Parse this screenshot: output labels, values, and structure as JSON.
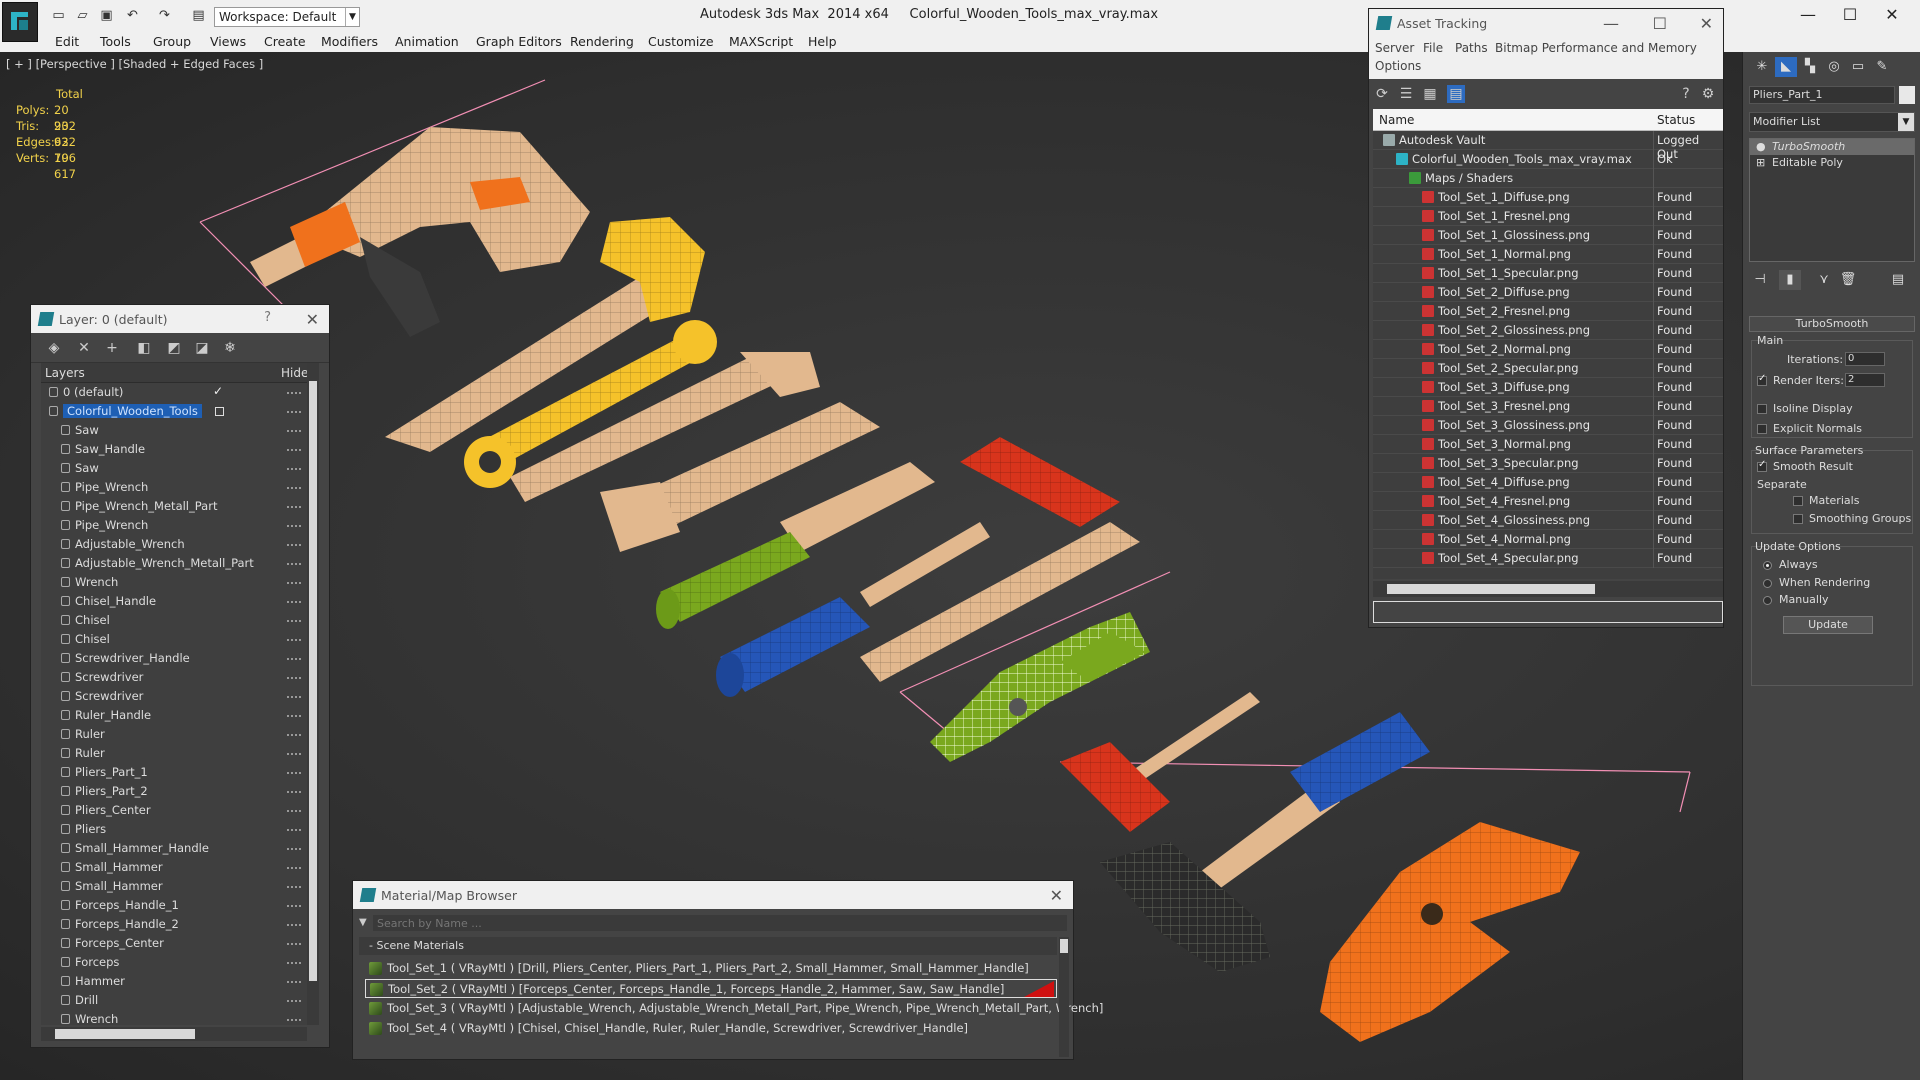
{
  "app": {
    "title": "Autodesk 3ds Max  2014 x64     Colorful_Wooden_Tools_max_vray.max",
    "workspace": "Workspace: Default",
    "window_controls": {
      "minimize": "—",
      "maximize": "☐",
      "close": "✕"
    }
  },
  "menu": [
    "Edit",
    "Tools",
    "Group",
    "Views",
    "Create",
    "Modifiers",
    "Animation",
    "Graph Editors",
    "Rendering",
    "Customize",
    "MAXScript",
    "Help"
  ],
  "viewport": {
    "label": "[ + ] [Perspective ] [Shaded + Edged Faces ]",
    "stats": {
      "header": "Total",
      "rows": [
        {
          "label": "Polys:",
          "value": "20 932"
        },
        {
          "label": "Tris:",
          "value": "20 932"
        },
        {
          "label": "Edges:",
          "value": "62 796"
        },
        {
          "label": "Verts:",
          "value": "10 617"
        }
      ]
    }
  },
  "layer_panel": {
    "title": "Layer: 0 (default)",
    "help": "?",
    "col_layers": "Layers",
    "col_hide": "Hide",
    "layers": [
      {
        "name": "0 (default)",
        "level": 1,
        "type": "layer",
        "checked": true
      },
      {
        "name": "Colorful_Wooden_Tools",
        "level": 1,
        "type": "layer",
        "selected": true
      },
      {
        "name": "Saw",
        "level": 2
      },
      {
        "name": "Saw_Handle",
        "level": 2
      },
      {
        "name": "Saw",
        "level": 2
      },
      {
        "name": "Pipe_Wrench",
        "level": 2
      },
      {
        "name": "Pipe_Wrench_Metall_Part",
        "level": 2
      },
      {
        "name": "Pipe_Wrench",
        "level": 2
      },
      {
        "name": "Adjustable_Wrench",
        "level": 2
      },
      {
        "name": "Adjustable_Wrench_Metall_Part",
        "level": 2
      },
      {
        "name": "Wrench",
        "level": 2
      },
      {
        "name": "Chisel_Handle",
        "level": 2
      },
      {
        "name": "Chisel",
        "level": 2
      },
      {
        "name": "Chisel",
        "level": 2
      },
      {
        "name": "Screwdriver_Handle",
        "level": 2
      },
      {
        "name": "Screwdriver",
        "level": 2
      },
      {
        "name": "Screwdriver",
        "level": 2
      },
      {
        "name": "Ruler_Handle",
        "level": 2
      },
      {
        "name": "Ruler",
        "level": 2
      },
      {
        "name": "Ruler",
        "level": 2
      },
      {
        "name": "Pliers_Part_1",
        "level": 2
      },
      {
        "name": "Pliers_Part_2",
        "level": 2
      },
      {
        "name": "Pliers_Center",
        "level": 2
      },
      {
        "name": "Pliers",
        "level": 2
      },
      {
        "name": "Small_Hammer_Handle",
        "level": 2
      },
      {
        "name": "Small_Hammer",
        "level": 2
      },
      {
        "name": "Small_Hammer",
        "level": 2
      },
      {
        "name": "Forceps_Handle_1",
        "level": 2
      },
      {
        "name": "Forceps_Handle_2",
        "level": 2
      },
      {
        "name": "Forceps_Center",
        "level": 2
      },
      {
        "name": "Forceps",
        "level": 2
      },
      {
        "name": "Hammer",
        "level": 2
      },
      {
        "name": "Drill",
        "level": 2
      },
      {
        "name": "Wrench",
        "level": 2
      }
    ]
  },
  "asset_panel": {
    "title": "Asset Tracking",
    "menu": [
      "Server",
      "File",
      "Paths",
      "Bitmap Performance and Memory",
      "Options"
    ],
    "col_name": "Name",
    "col_status": "Status",
    "rows": [
      {
        "name": "Autodesk Vault",
        "status": "Logged Out",
        "indent": 1,
        "icon": "vault"
      },
      {
        "name": "Colorful_Wooden_Tools_max_vray.max",
        "status": "Ok",
        "indent": 2,
        "icon": "max"
      },
      {
        "name": "Maps / Shaders",
        "status": "",
        "indent": 3,
        "icon": "maps"
      },
      {
        "name": "Tool_Set_1_Diffuse.png",
        "status": "Found",
        "indent": 4,
        "icon": "png"
      },
      {
        "name": "Tool_Set_1_Fresnel.png",
        "status": "Found",
        "indent": 4,
        "icon": "png"
      },
      {
        "name": "Tool_Set_1_Glossiness.png",
        "status": "Found",
        "indent": 4,
        "icon": "png"
      },
      {
        "name": "Tool_Set_1_Normal.png",
        "status": "Found",
        "indent": 4,
        "icon": "png"
      },
      {
        "name": "Tool_Set_1_Specular.png",
        "status": "Found",
        "indent": 4,
        "icon": "png"
      },
      {
        "name": "Tool_Set_2_Diffuse.png",
        "status": "Found",
        "indent": 4,
        "icon": "png"
      },
      {
        "name": "Tool_Set_2_Fresnel.png",
        "status": "Found",
        "indent": 4,
        "icon": "png"
      },
      {
        "name": "Tool_Set_2_Glossiness.png",
        "status": "Found",
        "indent": 4,
        "icon": "png"
      },
      {
        "name": "Tool_Set_2_Normal.png",
        "status": "Found",
        "indent": 4,
        "icon": "png"
      },
      {
        "name": "Tool_Set_2_Specular.png",
        "status": "Found",
        "indent": 4,
        "icon": "png"
      },
      {
        "name": "Tool_Set_3_Diffuse.png",
        "status": "Found",
        "indent": 4,
        "icon": "png"
      },
      {
        "name": "Tool_Set_3_Fresnel.png",
        "status": "Found",
        "indent": 4,
        "icon": "png"
      },
      {
        "name": "Tool_Set_3_Glossiness.png",
        "status": "Found",
        "indent": 4,
        "icon": "png"
      },
      {
        "name": "Tool_Set_3_Normal.png",
        "status": "Found",
        "indent": 4,
        "icon": "png"
      },
      {
        "name": "Tool_Set_3_Specular.png",
        "status": "Found",
        "indent": 4,
        "icon": "png"
      },
      {
        "name": "Tool_Set_4_Diffuse.png",
        "status": "Found",
        "indent": 4,
        "icon": "png"
      },
      {
        "name": "Tool_Set_4_Fresnel.png",
        "status": "Found",
        "indent": 4,
        "icon": "png"
      },
      {
        "name": "Tool_Set_4_Glossiness.png",
        "status": "Found",
        "indent": 4,
        "icon": "png"
      },
      {
        "name": "Tool_Set_4_Normal.png",
        "status": "Found",
        "indent": 4,
        "icon": "png"
      },
      {
        "name": "Tool_Set_4_Specular.png",
        "status": "Found",
        "indent": 4,
        "icon": "png"
      }
    ]
  },
  "command_panel": {
    "object_name": "Pliers_Part_1",
    "modifier_list": "Modifier List",
    "stack": [
      {
        "name": "TurboSmooth",
        "active": true
      },
      {
        "name": "Editable Poly",
        "active": false
      }
    ],
    "rollout_title": "TurboSmooth",
    "main_label": "Main",
    "iterations_label": "Iterations:",
    "iterations_value": "0",
    "render_iters_label": "Render Iters:",
    "render_iters_value": "2",
    "isoline_label": "Isoline Display",
    "explicit_normals_label": "Explicit Normals",
    "surface_params_label": "Surface Parameters",
    "smooth_result_label": "Smooth Result",
    "separate_label": "Separate",
    "materials_label": "Materials",
    "smoothing_groups_label": "Smoothing Groups",
    "update_options_label": "Update Options",
    "always_label": "Always",
    "when_rendering_label": "When Rendering",
    "manually_label": "Manually",
    "update_button": "Update"
  },
  "material_browser": {
    "title": "Material/Map Browser",
    "search_placeholder": "Search by Name ...",
    "group_title": "Scene Materials",
    "materials": [
      "Tool_Set_1  ( VRayMtl )  [Drill, Pliers_Center, Pliers_Part_1, Pliers_Part_2, Small_Hammer, Small_Hammer_Handle]",
      "Tool_Set_2  ( VRayMtl )  [Forceps_Center, Forceps_Handle_1, Forceps_Handle_2, Hammer, Saw, Saw_Handle]",
      "Tool_Set_3  ( VRayMtl )  [Adjustable_Wrench, Adjustable_Wrench_Metall_Part, Pipe_Wrench, Pipe_Wrench_Metall_Part, Wrench]",
      "Tool_Set_4  ( VRayMtl )  [Chisel, Chisel_Handle, Ruler, Ruler_Handle, Screwdriver, Screwdriver_Handle]"
    ]
  },
  "colors": {
    "wood": "#e2b88e",
    "orange": "#f0711c",
    "yellow": "#f5c22a",
    "green": "#7aa81e",
    "blue": "#2556b8",
    "red": "#d8341c",
    "black": "#2b2b2b",
    "selection": "#1e5fb4",
    "stats": "#f2d24a"
  }
}
